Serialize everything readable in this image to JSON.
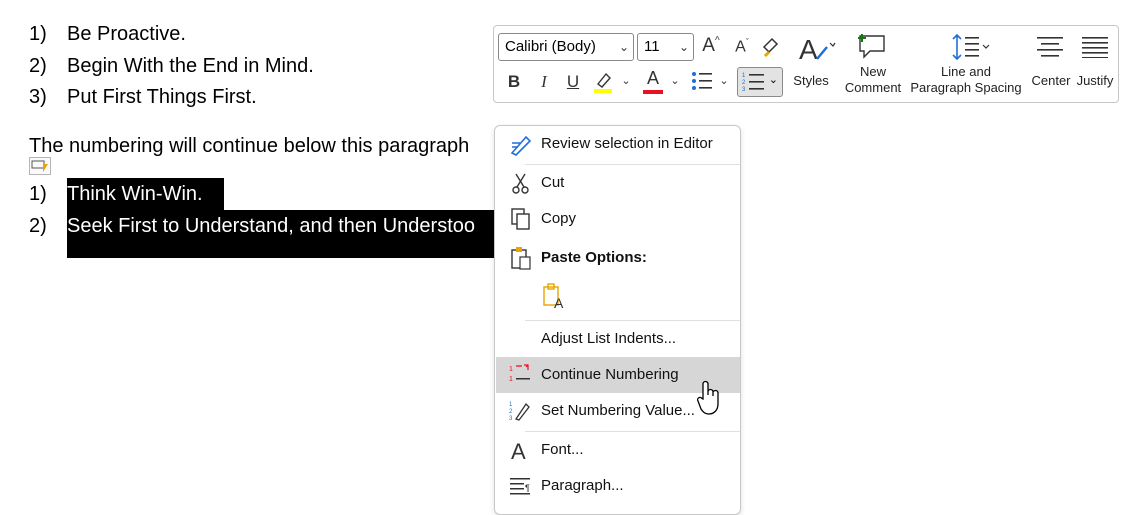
{
  "document": {
    "list1": [
      {
        "num": "1)",
        "text": "Be Proactive."
      },
      {
        "num": "2)",
        "text": "Begin With the End in Mind."
      },
      {
        "num": "3)",
        "text": "Put First Things First."
      }
    ],
    "paragraph": "The numbering will continue below this paragraph",
    "list2": [
      {
        "num": "1)",
        "text": "Think Win-Win."
      },
      {
        "num": "2)",
        "text": "Seek First to Understand, and then Understoo"
      }
    ]
  },
  "toolbar": {
    "font_name": "Calibri (Body)",
    "font_size": "11",
    "grow_font": "A",
    "shrink_font": "A",
    "bold": "B",
    "italic": "I",
    "underline": "U",
    "font_color_letter": "A",
    "styles_label": "Styles",
    "new_comment_line1": "New",
    "new_comment_line2": "Comment",
    "line_spacing_line1": "Line and",
    "line_spacing_line2": "Paragraph Spacing",
    "center_label": "Center",
    "justify_label": "Justify",
    "highlight_color": "#ffff00",
    "font_color": "#e81123"
  },
  "menu": {
    "review": "Review selection in Editor",
    "cut": "Cut",
    "copy": "Copy",
    "paste_options": "Paste Options:",
    "adjust_indents": "Adjust List Indents...",
    "continue_numbering": "Continue Numbering",
    "set_numbering": "Set Numbering Value...",
    "font": "Font...",
    "paragraph": "Paragraph..."
  }
}
